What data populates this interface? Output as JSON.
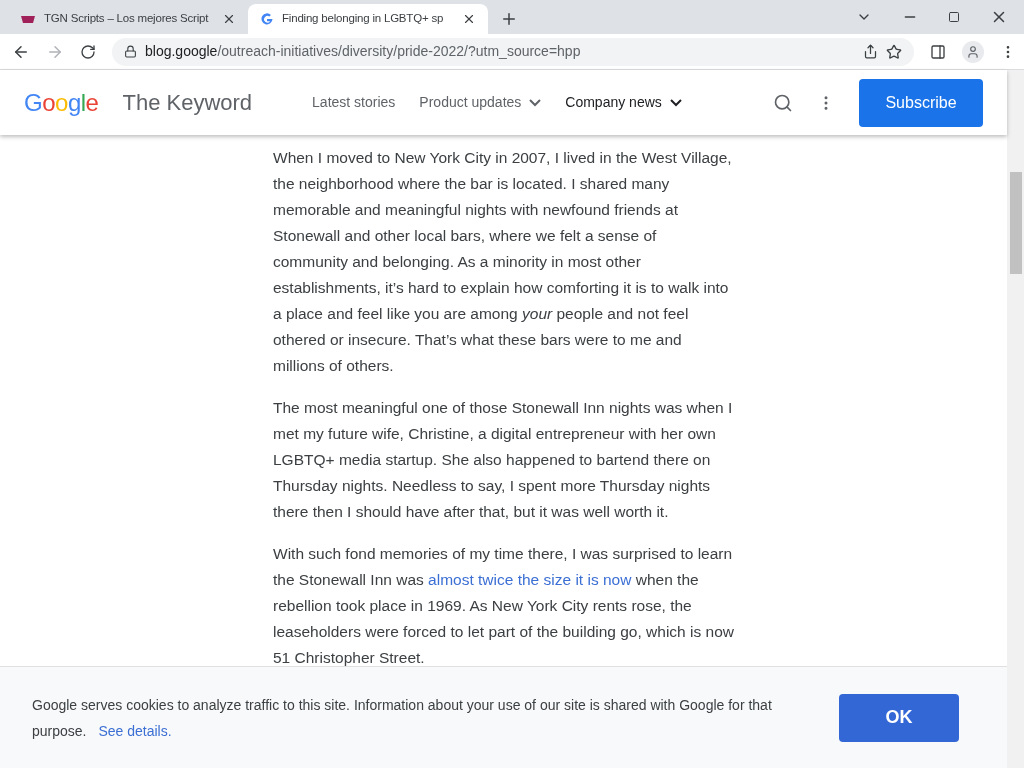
{
  "tabs": [
    {
      "title": "TGN Scripts – Los mejores Script",
      "selected": false,
      "kind": "tgn"
    },
    {
      "title": "Finding belonging in LGBTQ+ sp",
      "selected": true,
      "kind": "google"
    }
  ],
  "address_bar": {
    "domain": "blog.google",
    "path": "/outreach-initiatives/diversity/pride-2022/?utm_source=hpp"
  },
  "header": {
    "logo": "Google",
    "site_title": "The Keyword",
    "nav": [
      {
        "label": "Latest stories",
        "dropdown": false
      },
      {
        "label": "Product updates",
        "dropdown": true
      },
      {
        "label": "Company news",
        "dropdown": true
      }
    ],
    "subscribe": "Subscribe"
  },
  "article": {
    "paragraphs": [
      {
        "text": "When I moved to New York City in 2007, I lived in the West Village, the neighborhood where the bar is located. I shared many memorable and meaningful nights with newfound friends at Stonewall and other local bars, where we felt a sense of community and belonging. As a minority in most other establishments, it’s hard to explain how comforting it is to walk into a place and feel like you are among *your* people and not feel othered or insecure. That’s what these bars were to me and millions of others."
      },
      {
        "text": "The most meaningful one of those Stonewall Inn nights was when I met my future wife, Christine, a digital entrepreneur with her own LGBTQ+ media startup. She also happened to bartend there on Thursday nights. Needless to say, I spent more Thursday nights there then I should have after that, but it was well worth it."
      },
      {
        "text": "With such fond memories of my time there, I was surprised to learn the Stonewall Inn was",
        "link": "almost twice the size it is now",
        "text_after": "when the rebellion took place in 1969. As New York City rents rose, the leaseholders were forced to let part of the building go, which is now 51 Christopher Street."
      }
    ]
  },
  "cookie_banner": {
    "text": "Google serves cookies to analyze traffic to this site. Information about your use of our site is shared with Google for that purpose.",
    "link": "See details.",
    "button": "OK"
  }
}
